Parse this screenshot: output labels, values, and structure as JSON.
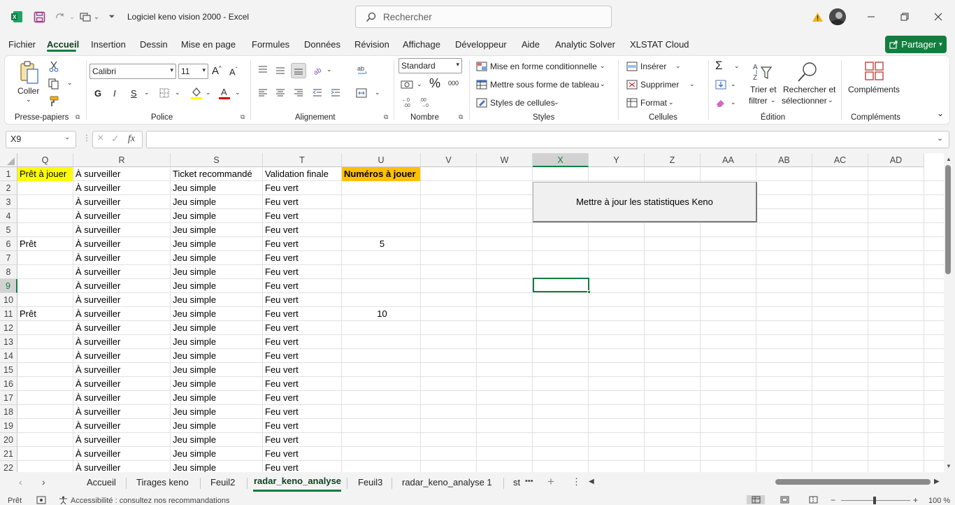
{
  "app": {
    "doc_title": "Logiciel keno vision 2000  -  Excel",
    "search_placeholder": "Rechercher"
  },
  "menu": {
    "items": [
      "Fichier",
      "Accueil",
      "Insertion",
      "Dessin",
      "Mise en page",
      "Formules",
      "Données",
      "Révision",
      "Affichage",
      "Développeur",
      "Aide",
      "Analytic Solver",
      "XLSTAT Cloud"
    ],
    "active": "Accueil",
    "share_label": "Partager"
  },
  "ribbon": {
    "clipboard": {
      "paste_label": "Coller",
      "group_label": "Presse-papiers"
    },
    "font": {
      "name": "Calibri",
      "size": "11",
      "bold": "G",
      "italic": "I",
      "underline": "S",
      "group_label": "Police"
    },
    "alignment": {
      "group_label": "Alignement"
    },
    "number": {
      "format": "Standard",
      "percent": "%",
      "thousands": "000",
      "group_label": "Nombre"
    },
    "styles": {
      "conditional": "Mise en forme conditionnelle",
      "table": "Mettre sous forme de tableau",
      "cell_styles": "Styles de cellules",
      "group_label": "Styles"
    },
    "cells": {
      "insert": "Insérer",
      "delete": "Supprimer",
      "format": "Format",
      "group_label": "Cellules"
    },
    "editing": {
      "sort_line1": "Trier et",
      "sort_line2": "filtrer",
      "find_line1": "Rechercher et",
      "find_line2": "sélectionner",
      "group_label": "Édition"
    },
    "addins": {
      "label": "Compléments",
      "group_label": "Compléments"
    }
  },
  "formula_bar": {
    "name_box": "X9",
    "cancel_icon": "×",
    "enter_icon": "✓",
    "fx": "fx",
    "content": ""
  },
  "sheet": {
    "columns": [
      "Q",
      "R",
      "S",
      "T",
      "U",
      "V",
      "W",
      "X",
      "Y",
      "Z",
      "AA",
      "AB",
      "AC",
      "AD"
    ],
    "selected_column": "X",
    "selected_row": "9",
    "rows": [
      "1",
      "2",
      "3",
      "4",
      "5",
      "6",
      "7",
      "8",
      "9",
      "10",
      "11",
      "12",
      "13",
      "14",
      "15",
      "16",
      "17",
      "18",
      "19",
      "20",
      "21",
      "22"
    ],
    "header_row": {
      "Q": "Prêt à jouer",
      "R": "À surveiller",
      "S": "Ticket recommandé",
      "T": "Validation finale",
      "U": "Numéros à jouer"
    },
    "r_value": "À surveiller",
    "s_value": "Jeu simple",
    "t_value": "Feu vert",
    "q_values": {
      "6": "Prêt",
      "11": "Prêt"
    },
    "u_values": {
      "6": "5",
      "11": "10"
    },
    "macro_button": "Mettre à jour les statistiques Keno"
  },
  "tabs": {
    "items": [
      "Accueil",
      "Tirages keno",
      "Feuil2",
      "radar_keno_analyse",
      "Feuil3",
      "radar_keno_analyse 1",
      "st"
    ],
    "active": "radar_keno_analyse",
    "more": "•••",
    "add": "+"
  },
  "status": {
    "ready": "Prêt",
    "accessibility": "Accessibilité : consultez nos recommandations",
    "zoom": "100 %"
  },
  "colors": {
    "accent": "#117e3f",
    "yellow_fill": "#ffff00",
    "orange_fill": "#ffc000"
  }
}
